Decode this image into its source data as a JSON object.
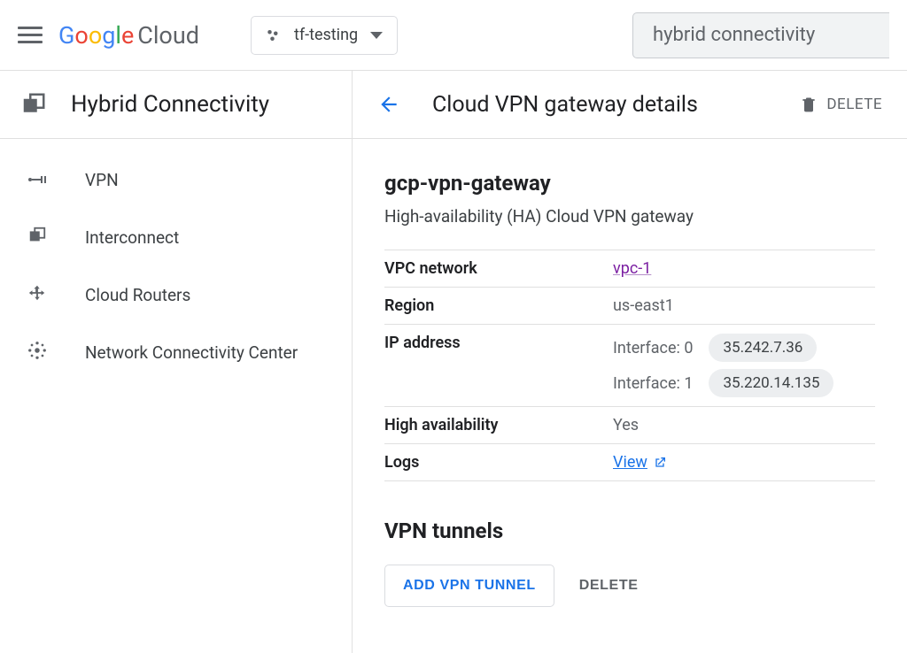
{
  "header": {
    "logo_g": "Google",
    "logo_cloud": "Cloud",
    "project_name": "tf-testing",
    "search_value": "hybrid connectivity"
  },
  "sidebar": {
    "title": "Hybrid Connectivity",
    "items": [
      {
        "label": "VPN"
      },
      {
        "label": "Interconnect"
      },
      {
        "label": "Cloud Routers"
      },
      {
        "label": "Network Connectivity Center"
      }
    ]
  },
  "page": {
    "title": "Cloud VPN gateway details",
    "delete_label": "DELETE"
  },
  "gateway": {
    "name": "gcp-vpn-gateway",
    "description": "High-availability (HA) Cloud VPN gateway",
    "vpc_label": "VPC network",
    "vpc_value": "vpc-1",
    "region_label": "Region",
    "region_value": "us-east1",
    "ip_label": "IP address",
    "interfaces": [
      {
        "label": "Interface: 0",
        "ip": "35.242.7.36"
      },
      {
        "label": "Interface: 1",
        "ip": "35.220.14.135"
      }
    ],
    "ha_label": "High availability",
    "ha_value": "Yes",
    "logs_label": "Logs",
    "logs_link": "View"
  },
  "tunnels": {
    "title": "VPN tunnels",
    "add_label": "ADD VPN TUNNEL",
    "delete_label": "DELETE"
  }
}
